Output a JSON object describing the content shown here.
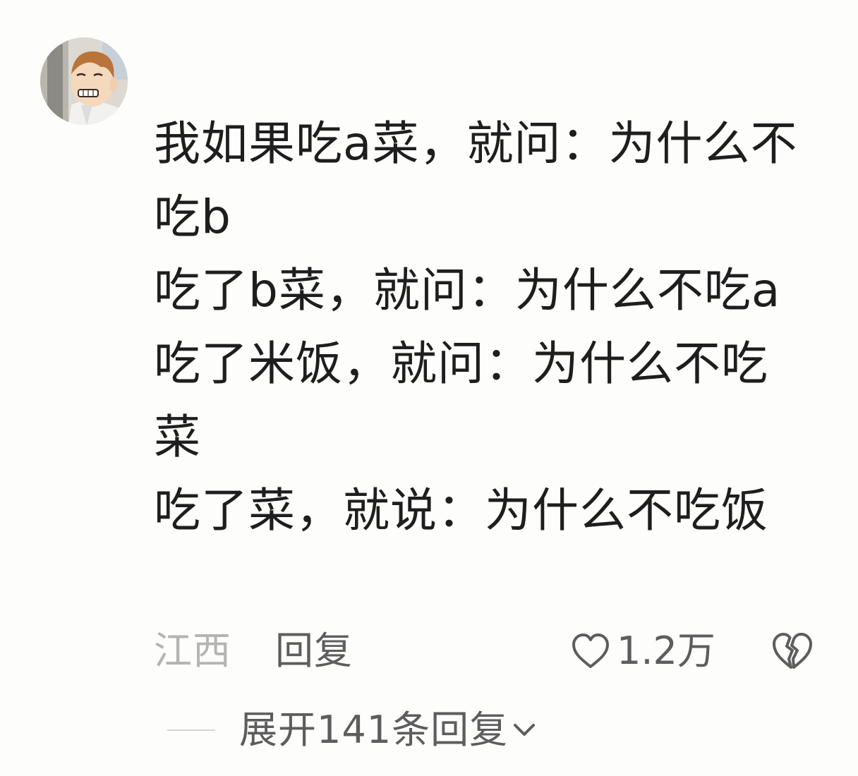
{
  "comment": {
    "lines": [
      "我如果吃a菜，就问：为什么不",
      "吃b",
      "吃了b菜，就问：为什么不吃a",
      "吃了米饭，就问：为什么不吃",
      "菜",
      "吃了菜，就说：为什么不吃饭"
    ],
    "location": "江西",
    "reply_label": "回复",
    "like_count": "1.2万"
  },
  "replies": {
    "expand_label": "展开141条回复"
  },
  "colors": {
    "text": "#1e1e1e",
    "muted": "#5d5d5d",
    "light": "#b4b4b4",
    "background": "#fdfdfb"
  },
  "icons": {
    "like": "heart-outline-icon",
    "dislike": "broken-heart-icon",
    "expand": "chevron-down-icon"
  }
}
